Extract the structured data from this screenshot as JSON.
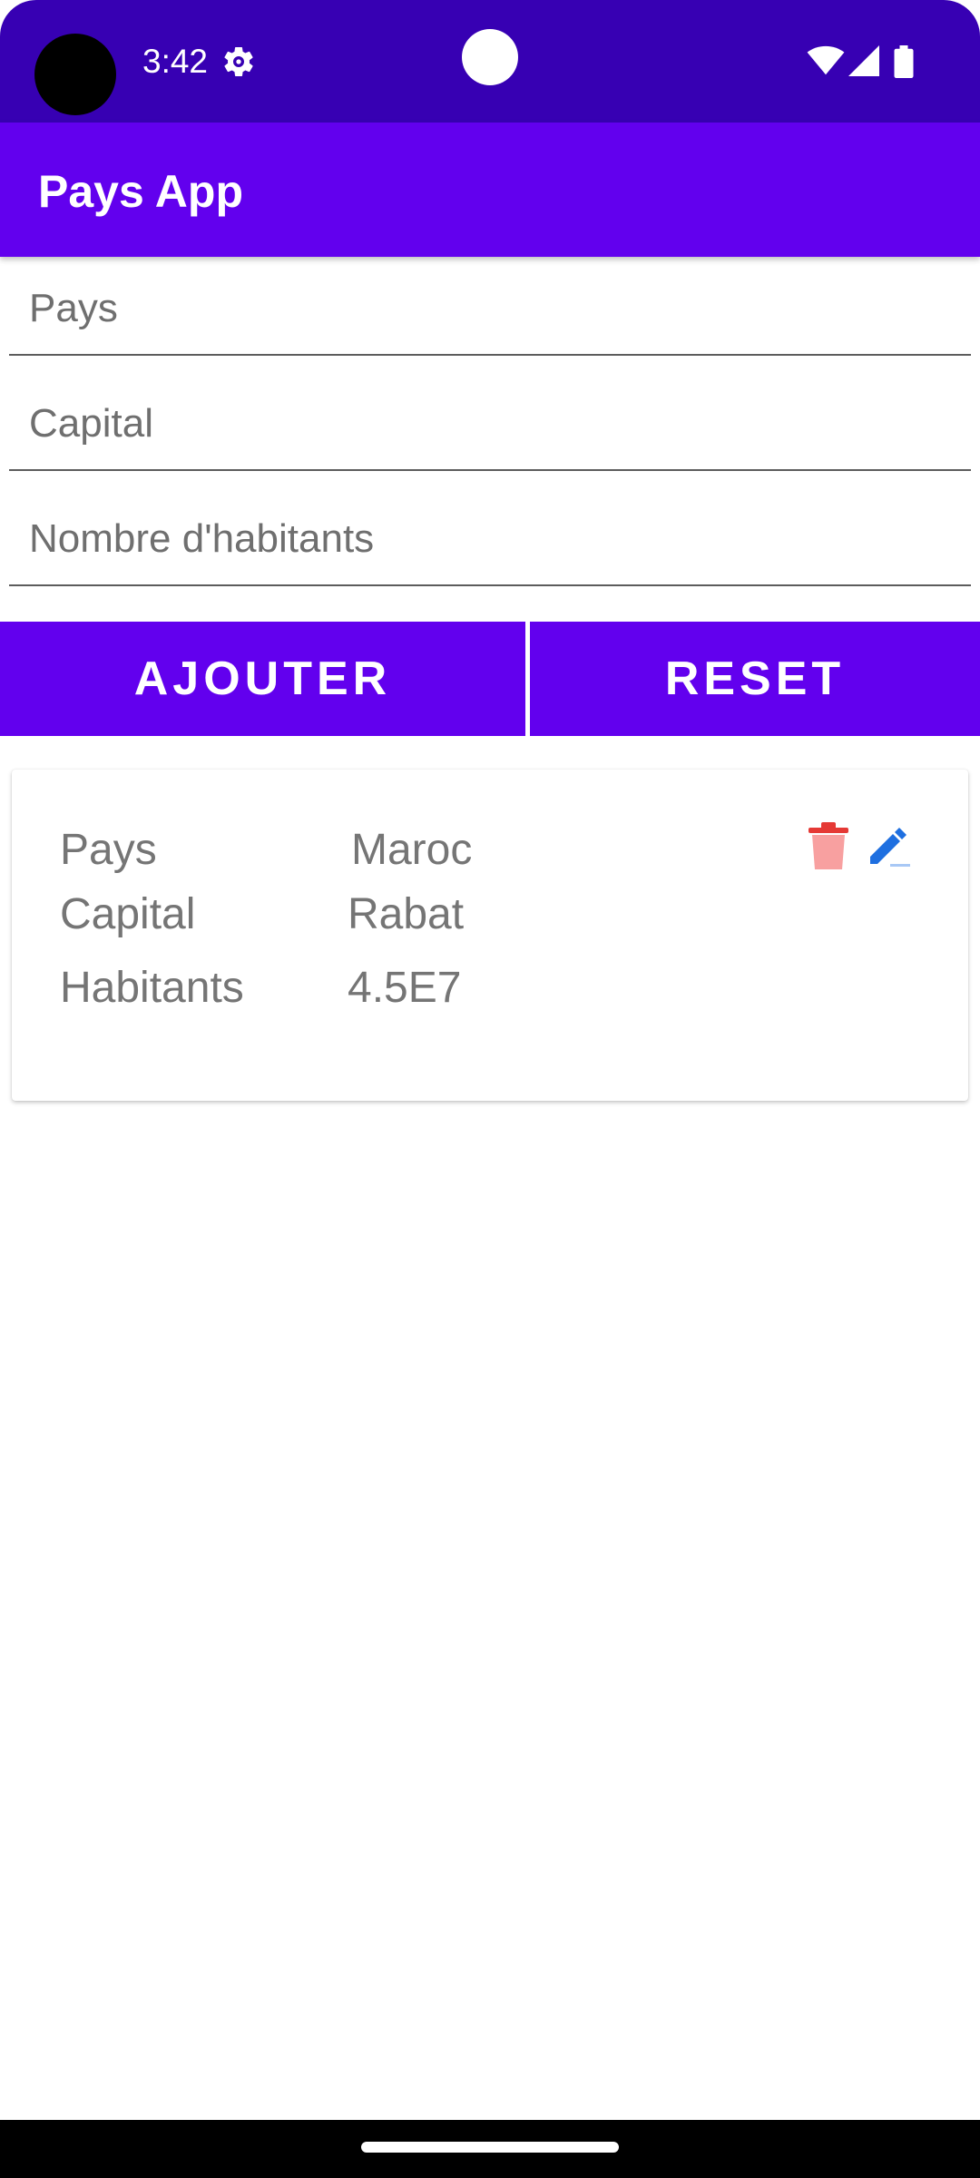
{
  "status_bar": {
    "time": "3:42",
    "icons": [
      "settings-icon",
      "wifi-icon",
      "signal-icon",
      "battery-icon"
    ]
  },
  "app_bar": {
    "title": "Pays App"
  },
  "form": {
    "pays_placeholder": "Pays",
    "pays_value": "",
    "capital_placeholder": "Capital",
    "capital_value": "",
    "habitants_placeholder": "Nombre d'habitants",
    "habitants_value": "",
    "add_label": "AJOUTER",
    "reset_label": "RESET"
  },
  "countries": [
    {
      "pays_label": "Pays",
      "pays": "Maroc",
      "capital_label": "Capital",
      "capital": "Rabat",
      "habitants_label": "Habitants",
      "habitants": "4.5E7",
      "actions": [
        "delete-icon",
        "edit-icon"
      ]
    }
  ],
  "colors": {
    "status_bar": "#3700b3",
    "primary": "#6200ee",
    "delete": "#e53935",
    "edit": "#1e6fe0",
    "card_text": "#757575"
  }
}
